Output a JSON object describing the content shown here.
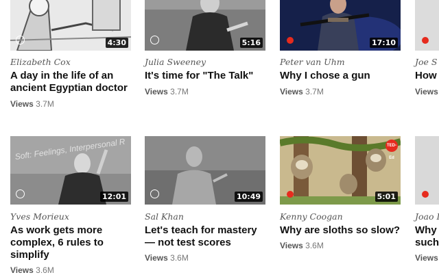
{
  "talks": [
    {
      "speaker": "Elizabeth Cox",
      "title": "A day in the life of an ancient Egyptian doctor",
      "views_label": "Views",
      "views": "3.7M",
      "duration": "4:30",
      "watched": false
    },
    {
      "speaker": "Julia Sweeney",
      "title": "It's time for \"The Talk\"",
      "views_label": "Views",
      "views": "3.7M",
      "duration": "5:16",
      "watched": false
    },
    {
      "speaker": "Peter van Uhm",
      "title": "Why I chose a gun",
      "views_label": "Views",
      "views": "3.7M",
      "duration": "17:10",
      "watched": true
    },
    {
      "speaker": "Joe S",
      "title": "How",
      "views_label": "Views",
      "views": "",
      "duration": "",
      "watched": true
    },
    {
      "speaker": "Yves Morieux",
      "title": "As work gets more complex, 6 rules to simplify",
      "views_label": "Views",
      "views": "3.6M",
      "duration": "12:01",
      "watched": false
    },
    {
      "speaker": "Sal Khan",
      "title": "Let's teach for mastery — not test scores",
      "views_label": "Views",
      "views": "3.6M",
      "duration": "10:49",
      "watched": false
    },
    {
      "speaker": "Kenny Coogan",
      "title": "Why are sloths so slow?",
      "views_label": "Views",
      "views": "3.6M",
      "duration": "5:01",
      "watched": true,
      "badge": "TED-Ed"
    },
    {
      "speaker": "Joao I",
      "title": "Why such",
      "views_label": "Views",
      "views": "",
      "duration": "",
      "watched": true
    }
  ],
  "thumbnail_background_text": "Soft: Feelings, Interpersonal R",
  "colors": {
    "accent": "#e62b1e",
    "title": "#111111",
    "meta": "#777777"
  }
}
